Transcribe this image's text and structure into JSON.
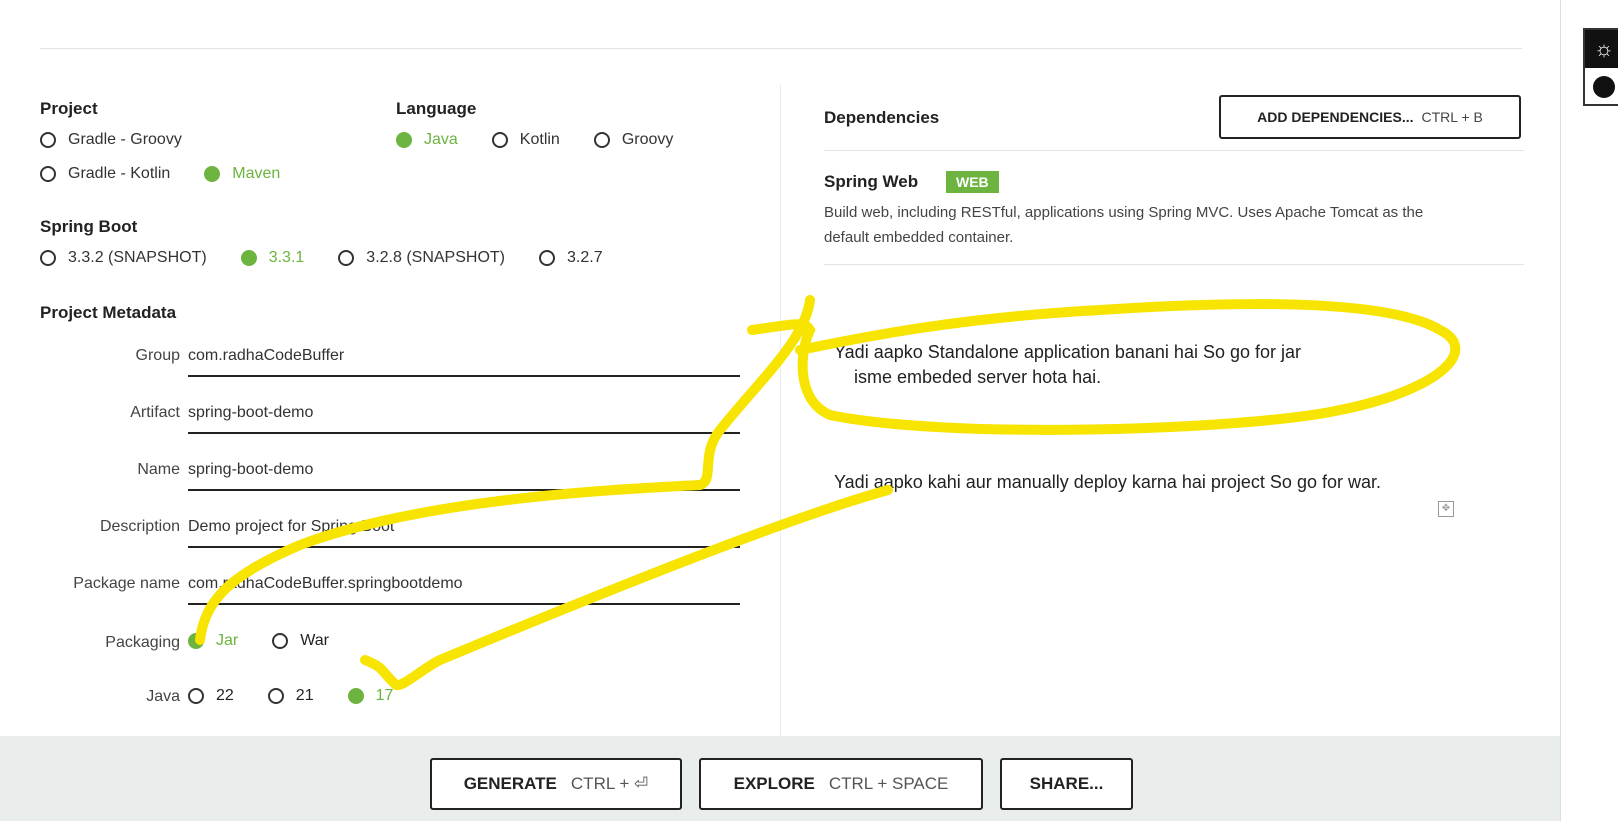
{
  "project": {
    "title": "Project",
    "options": [
      "Gradle - Groovy",
      "Gradle - Kotlin",
      "Maven"
    ],
    "selected": "Maven"
  },
  "language": {
    "title": "Language",
    "options": [
      "Java",
      "Kotlin",
      "Groovy"
    ],
    "selected": "Java"
  },
  "spring_boot": {
    "title": "Spring Boot",
    "options": [
      "3.3.2 (SNAPSHOT)",
      "3.3.1",
      "3.2.8 (SNAPSHOT)",
      "3.2.7"
    ],
    "selected": "3.3.1"
  },
  "metadata": {
    "title": "Project Metadata",
    "group": {
      "label": "Group",
      "value": "com.radhaCodeBuffer"
    },
    "artifact": {
      "label": "Artifact",
      "value": "spring-boot-demo"
    },
    "name": {
      "label": "Name",
      "value": "spring-boot-demo"
    },
    "description": {
      "label": "Description",
      "value": "Demo project for Spring Boot"
    },
    "package_name": {
      "label": "Package name",
      "value": "com.radhaCodeBuffer.springbootdemo"
    },
    "packaging": {
      "label": "Packaging",
      "options": [
        "Jar",
        "War"
      ],
      "selected": "Jar"
    },
    "java": {
      "label": "Java",
      "options": [
        "22",
        "21",
        "17"
      ],
      "selected": "17"
    }
  },
  "dependencies": {
    "title": "Dependencies",
    "add_button": {
      "label": "ADD DEPENDENCIES...",
      "shortcut": "CTRL + B"
    },
    "items": [
      {
        "name": "Spring Web",
        "badge": "WEB",
        "description": "Build web, including RESTful, applications using Spring MVC. Uses Apache Tomcat as the default embedded container."
      }
    ]
  },
  "annotations": {
    "note1_line1": "Yadi aapko Standalone application banani hai  So go for jar",
    "note1_line2": "isme embeded server hota hai.",
    "note2": "Yadi aapko kahi aur manually deploy karna hai project So go for war.",
    "highlight_color": "#f7e400"
  },
  "actions": {
    "generate": {
      "label": "GENERATE",
      "shortcut": "CTRL + ⏎"
    },
    "explore": {
      "label": "EXPLORE",
      "shortcut": "CTRL + SPACE"
    },
    "share": {
      "label": "SHARE..."
    }
  },
  "colors": {
    "accent": "#6db33f",
    "bottom_bar": "#e9eeed"
  },
  "icons": [
    "theme-toggle-icon",
    "moon-icon",
    "move-handle-icon"
  ]
}
